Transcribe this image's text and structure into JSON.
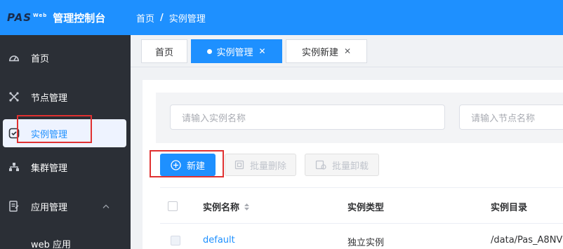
{
  "header": {
    "logo_text": "PAS",
    "logo_sup": "Web",
    "app_title": "管理控制台",
    "breadcrumb": [
      "首页",
      "实例管理"
    ],
    "breadcrumb_sep": "/"
  },
  "sidebar": {
    "items": [
      {
        "label": "首页",
        "icon": "dashboard-icon"
      },
      {
        "label": "节点管理",
        "icon": "nodes-icon"
      },
      {
        "label": "实例管理",
        "icon": "instance-icon",
        "active": true
      },
      {
        "label": "集群管理",
        "icon": "cluster-icon"
      },
      {
        "label": "应用管理",
        "icon": "app-icon",
        "expanded": true
      }
    ],
    "sub_items": [
      "web 应用"
    ]
  },
  "tabs": [
    {
      "label": "首页"
    },
    {
      "label": "实例管理",
      "active": true,
      "close": "✕"
    },
    {
      "label": "实例新建",
      "close": "✕"
    }
  ],
  "filters": {
    "instance_name_placeholder": "请输入实例名称",
    "node_name_placeholder": "请输入节点名称"
  },
  "toolbar": {
    "new_label": "新建",
    "batch_delete_label": "批量删除",
    "batch_uninstall_label": "批量卸载"
  },
  "table": {
    "columns": [
      "实例名称",
      "实例类型",
      "实例目录"
    ],
    "rows": [
      {
        "name": "default",
        "type": "独立实例",
        "dir": "/data/Pas_A8NV"
      }
    ]
  },
  "colors": {
    "primary": "#1e90ff",
    "sidebar_bg": "#2b2f36",
    "highlight_box": "#e03131"
  }
}
